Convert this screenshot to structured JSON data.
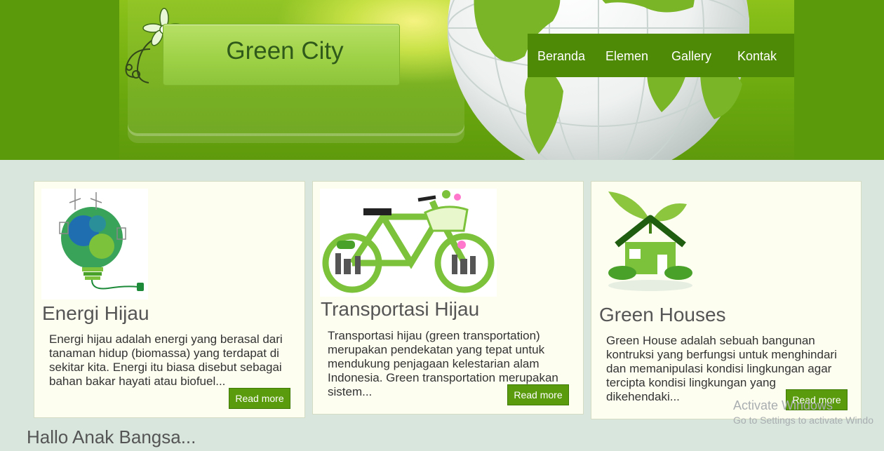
{
  "header": {
    "site_title": "Green City",
    "colors": {
      "header_bg": "#5b9a0a",
      "nav_bg": "#4f8a06"
    }
  },
  "nav": {
    "items": [
      {
        "label": "Beranda"
      },
      {
        "label": "Elemen"
      },
      {
        "label": "Gallery"
      },
      {
        "label": "Kontak"
      }
    ]
  },
  "cards": [
    {
      "title": "Energi Hijau",
      "text": "Energi hijau adalah energi yang berasal dari tanaman hidup (biomassa) yang terdapat di sekitar kita. Energi itu biasa disebut sebagai bahan bakar hayati atau biofuel...",
      "button": "Read more",
      "image": "green-energy-bulb-icon"
    },
    {
      "title": "Transportasi Hijau",
      "text": "Transportasi hijau (green transportation) merupakan pendekatan yang tepat untuk mendukung penjagaan kelestarian alam Indonesia. Green transportation merupakan sistem...",
      "button": "Read more",
      "image": "green-bicycle-icon"
    },
    {
      "title": "Green Houses",
      "text": "Green House adalah sebuah bangunan kontruksi yang berfungsi untuk menghindari dan memanipulasi kondisi lingkungan agar tercipta kondisi lingkungan yang dikehendaki...",
      "button": "Read more",
      "image": "green-house-icon"
    }
  ],
  "footer": {
    "greeting": "Hallo Anak Bangsa..."
  },
  "watermark": {
    "line1": "Activate Windows",
    "line2": "Go to Settings to activate Windo"
  }
}
